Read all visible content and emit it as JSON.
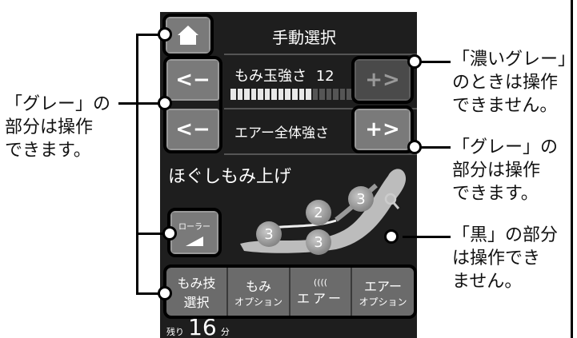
{
  "screen": {
    "title": "手動選択",
    "intensity_label": "もみ玉強さ",
    "intensity_value": "12",
    "intensity_level": 12,
    "intensity_max": 18,
    "air_label": "エアー全体強さ",
    "minus_label": "<−",
    "plus_label": "+>",
    "course_name": "ほぐしもみ上げ",
    "roller_label": "ローラー",
    "body_markers": [
      "3",
      "2",
      "3",
      "3"
    ],
    "tabs": [
      {
        "line1": "もみ技",
        "line2": "選択"
      },
      {
        "line1": "もみ",
        "line2": "オプション"
      },
      {
        "line1": "((((",
        "line2": "エアー"
      },
      {
        "line1": "エアー",
        "line2": "オプション"
      }
    ],
    "remaining_label": "残り",
    "remaining_value": "16",
    "remaining_unit": "分"
  },
  "annotations": {
    "left_line1": "「グレー」の",
    "left_line2": "部分は操作",
    "left_line3": "できます。",
    "right_top_line1": "「濃いグレー」",
    "right_top_line2": "のときは操作",
    "right_top_line3": "できません。",
    "right_mid_line1": "「グレー」の",
    "right_mid_line2": "部分は操作",
    "right_mid_line3": "できます。",
    "right_bottom_line1": "「黒」の部分",
    "right_bottom_line2": "は操作でき",
    "right_bottom_line3": "ません。"
  },
  "colors": {
    "screen_bg": "#1e1e1e",
    "gray_button": "#7a7a7a",
    "dark_gray_button": "#4a4a4a"
  }
}
